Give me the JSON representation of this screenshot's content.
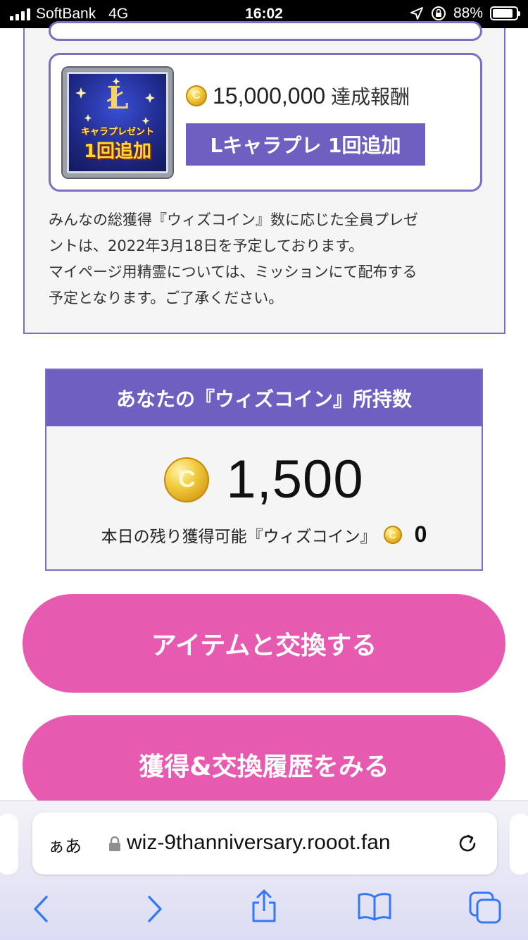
{
  "status_bar": {
    "carrier": "SoftBank",
    "network": "4G",
    "time": "16:02",
    "battery": "88%",
    "battery_level": 0.88
  },
  "reward": {
    "image_caption_top": "キャラプレゼント",
    "image_caption_main": "1回追加",
    "amount": "15,000,000",
    "amount_suffix": "達成報酬",
    "tag": "Lキャラプレ 1回追加"
  },
  "notice": {
    "lines": [
      "みんなの総獲得『ウィズコイン』数に応じた全員プレゼ",
      "ントは、2022年3月18日を予定しております。",
      "マイページ用精霊については、ミッションにて配布する",
      "予定となります。ご了承ください。"
    ]
  },
  "coin_box": {
    "title": "あなたの『ウィズコイン』所持数",
    "balance": "1,500",
    "remaining_label": "本日の残り獲得可能『ウィズコイン』",
    "remaining_value": "0"
  },
  "buttons": {
    "exchange": "アイテムと交換する",
    "history": "獲得&交換履歴をみる"
  },
  "browser": {
    "aa_label": "ぁあ",
    "url": "wiz-9thanniversary.rooot.fan"
  },
  "colors": {
    "accent_purple": "#6f5fc0",
    "button_pink": "#e65ab0",
    "ios_blue": "#3478f6"
  }
}
